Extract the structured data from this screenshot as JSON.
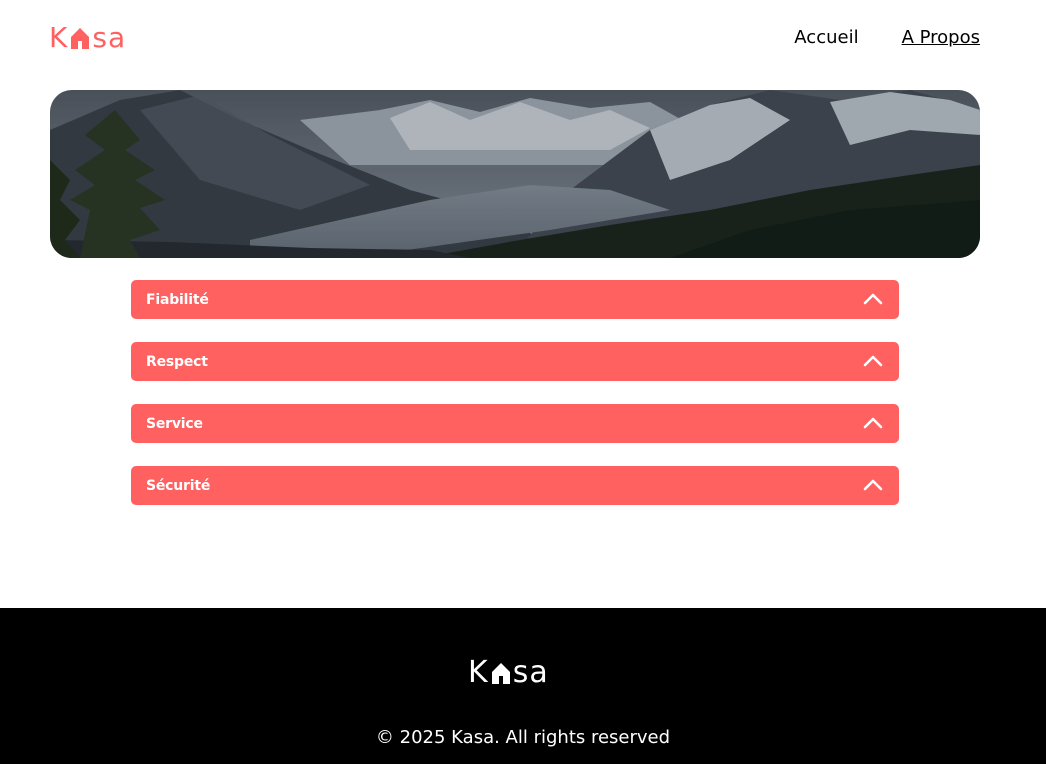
{
  "header": {
    "logo": {
      "letter_k": "K",
      "letters_sa": "sa"
    },
    "nav": [
      {
        "label": "Accueil",
        "active": false
      },
      {
        "label": "A Propos",
        "active": true
      }
    ]
  },
  "banner": {
    "icon": "mountain-landscape-image"
  },
  "collapses": [
    {
      "title": "Fiabilité"
    },
    {
      "title": "Respect"
    },
    {
      "title": "Service"
    },
    {
      "title": "Sécurité"
    }
  ],
  "footer": {
    "logo": {
      "letter_k": "K",
      "letters_sa": "sa"
    },
    "copyright": "© 2025 Kasa. All rights reserved"
  },
  "colors": {
    "accent": "#FF6060",
    "footer_bg": "#000000",
    "text": "#000000"
  }
}
